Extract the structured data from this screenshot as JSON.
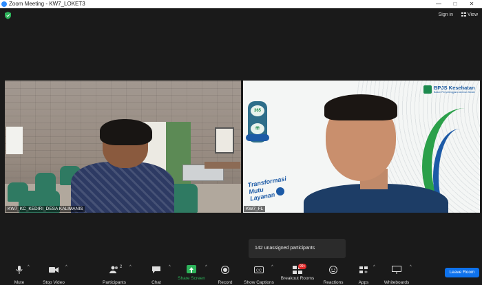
{
  "window": {
    "title": "Zoom Meeting - KW7_LOKET3",
    "minimize_glyph": "—",
    "maximize_glyph": "□",
    "close_glyph": "✕"
  },
  "topbar": {
    "sign_in": "Sign in",
    "view": "View"
  },
  "participants": [
    {
      "name": "KW7_KC_KEDIRI_DESA KALIMANIS"
    },
    {
      "name": "KW7_FL"
    }
  ],
  "right_tile": {
    "logo_text": "BPJS Kesehatan",
    "logo_sub": "Badan Penyelenggara Jaminan Sosial",
    "badge1": "365",
    "slogan_line1": "Transformasi",
    "slogan_line2": "Mutu",
    "slogan_line3": "Layanan"
  },
  "toast": {
    "text": "142 unassigned participants"
  },
  "toolbar": {
    "mute": "Mute",
    "stop_video": "Stop Video",
    "participants": "Participants",
    "participants_count": "2",
    "chat": "Chat",
    "share_screen": "Share Screen",
    "record": "Record",
    "show_captions": "Show Captions",
    "breakout_rooms": "Breakout Rooms",
    "breakout_badge": "99+",
    "reactions": "Reactions",
    "apps": "Apps",
    "whiteboards": "Whiteboards",
    "leave_room": "Leave Room"
  },
  "colors": {
    "accent": "#0e72ed",
    "share_green": "#2db35a",
    "bpjs_green": "#1d8a4e",
    "bpjs_blue": "#1b5aa0"
  }
}
